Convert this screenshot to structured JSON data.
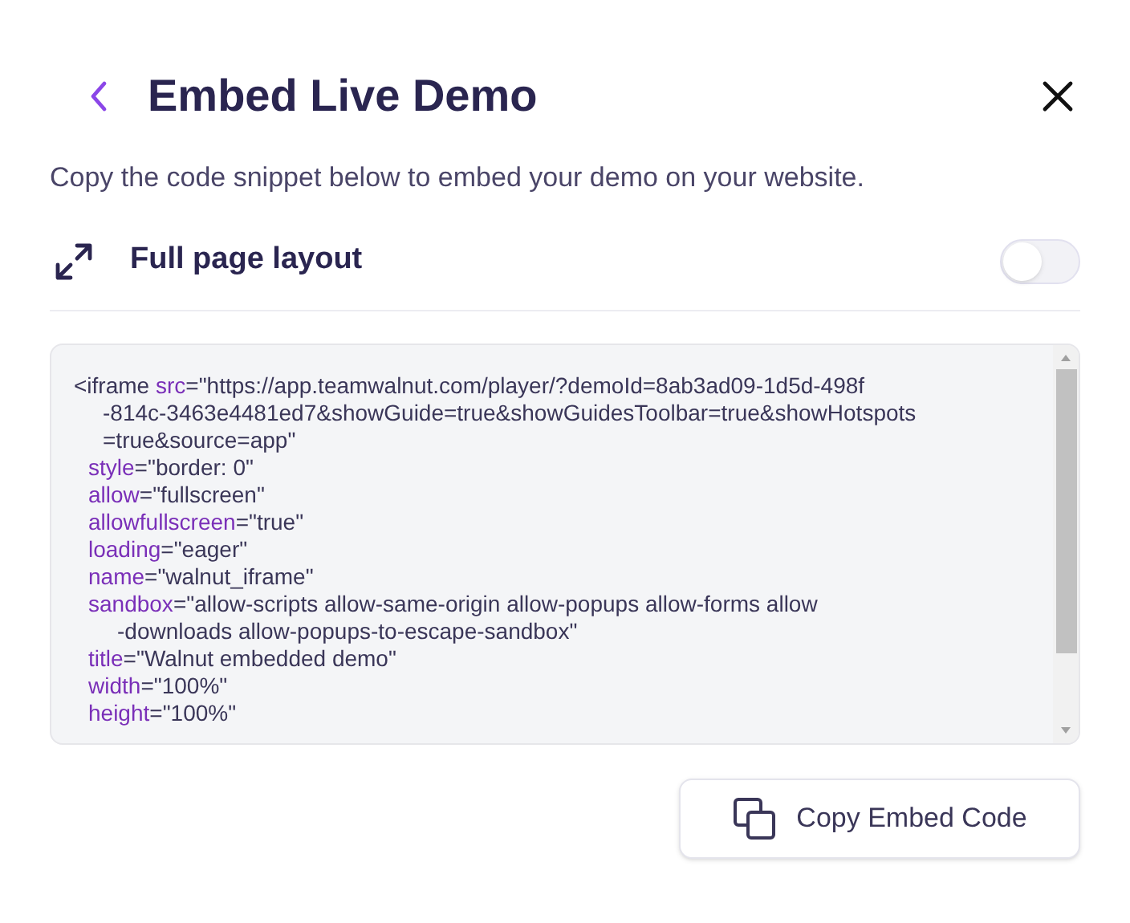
{
  "header": {
    "title": "Embed Live Demo"
  },
  "description": "Copy the code snippet below to embed your demo on your website.",
  "full_page_layout": {
    "label": "Full page layout",
    "on": false
  },
  "code": {
    "tag_open": "<iframe",
    "attributes": [
      {
        "name": "src",
        "value": "=\"https://app.teamwalnut.com/player/?demoId=8ab3ad09-1d5d-498f",
        "continued": [
          "-814c-3463e4481ed7&showGuide=true&showGuidesToolbar=true&showHotspots",
          "=true&source=app\""
        ]
      },
      {
        "name": "style",
        "value": "=\"border: 0\""
      },
      {
        "name": "allow",
        "value": "=\"fullscreen\""
      },
      {
        "name": "allowfullscreen",
        "value": "=\"true\""
      },
      {
        "name": "loading",
        "value": "=\"eager\""
      },
      {
        "name": "name",
        "value": "=\"walnut_iframe\""
      },
      {
        "name": "sandbox",
        "value": "=\"allow-scripts allow-same-origin allow-popups allow-forms allow",
        "continued": [
          "-downloads allow-popups-to-escape-sandbox\""
        ]
      },
      {
        "name": "title",
        "value": "=\"Walnut embedded demo\""
      },
      {
        "name": "width",
        "value": "=\"100%\""
      },
      {
        "name": "height",
        "value": "=\"100%\""
      }
    ]
  },
  "copy_button": {
    "label": "Copy Embed Code"
  }
}
